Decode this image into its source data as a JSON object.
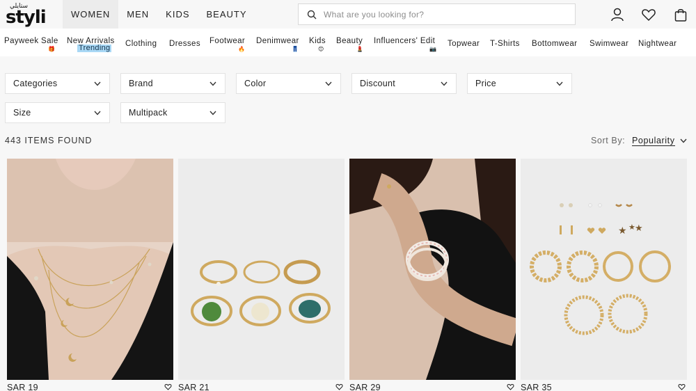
{
  "brand": {
    "logo_arabic": "ستايلي",
    "logo_text": "styli"
  },
  "nav_main": [
    {
      "label": "WOMEN",
      "active": true
    },
    {
      "label": "MEN",
      "active": false
    },
    {
      "label": "KIDS",
      "active": false
    },
    {
      "label": "BEAUTY",
      "active": false
    }
  ],
  "search": {
    "placeholder": "What are you looking for?"
  },
  "header_icons": [
    "user-icon",
    "heart-icon",
    "bag-icon"
  ],
  "subnav": [
    {
      "label": "Payweek Sale",
      "badge_icon": "gift-icon"
    },
    {
      "label": "New Arrivals",
      "tag": "Trending"
    },
    {
      "label": "Clothing"
    },
    {
      "label": "Dresses"
    },
    {
      "label": "Footwear",
      "badge_icon": "fire-icon"
    },
    {
      "label": "Denimwear",
      "badge_icon": "jeans-icon"
    },
    {
      "label": "Kids",
      "badge_icon": "smile-icon"
    },
    {
      "label": "Beauty",
      "badge_icon": "lipstick-icon"
    },
    {
      "label": "Influencers' Edit",
      "badge_icon": "camera-icon"
    },
    {
      "label": "Topwear"
    },
    {
      "label": "T-Shirts"
    },
    {
      "label": "Bottomwear"
    },
    {
      "label": "Swimwear"
    },
    {
      "label": "Nightwear"
    }
  ],
  "filters": [
    {
      "label": "Categories"
    },
    {
      "label": "Brand"
    },
    {
      "label": "Color"
    },
    {
      "label": "Discount"
    },
    {
      "label": "Price"
    },
    {
      "label": "Size"
    },
    {
      "label": "Multipack"
    }
  ],
  "results": {
    "count_text": "443 ITEMS FOUND",
    "sort_label": "Sort By:",
    "sort_value": "Popularity"
  },
  "products": [
    {
      "price": "SAR 19",
      "image": "necklace-model"
    },
    {
      "price": "SAR 21",
      "image": "rings-set"
    },
    {
      "price": "SAR 29",
      "image": "bracelet-model"
    },
    {
      "price": "SAR 35",
      "image": "earrings-set"
    }
  ],
  "colors": {
    "accent_tag": "#a9d8f5",
    "text": "#222222",
    "background": "#f7f7f7"
  }
}
